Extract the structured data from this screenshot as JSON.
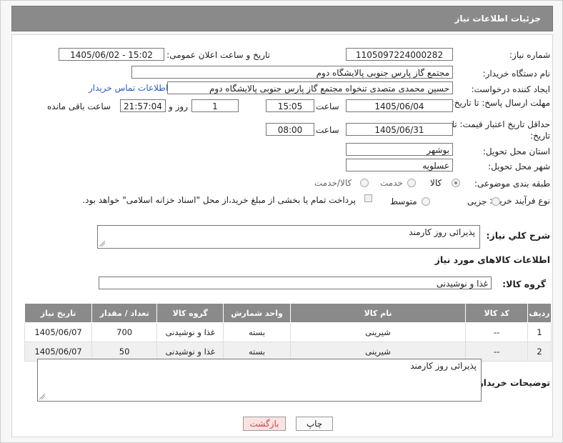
{
  "header": {
    "title": "جزئیات اطلاعات نیاز"
  },
  "fields": {
    "need_number_label": "شماره نیاز:",
    "need_number": "1105097224000282",
    "announce_label": "تاریخ و ساعت اعلان عمومی:",
    "announce_value": "1405/06/02 - 15:02",
    "buyer_org_label": "نام دستگاه خریدار:",
    "buyer_org": "مجتمع گاز پارس جنوبی  پالایشگاه دوم",
    "requester_label": "ایجاد کننده درخواست:",
    "requester": "حسین محمدی متصدی تنخواه مجتمع گاز پارس جنوبی  پالایشگاه دوم",
    "contact_link": "اطلاعات تماس خریدار",
    "reply_deadline_label": "مهلت ارسال پاسخ: تا تاریخ:",
    "reply_date": "1405/06/04",
    "time_label": "ساعت",
    "reply_time": "15:05",
    "days_value": "1",
    "days_label": "روز و",
    "remaining_time": "21:57:04",
    "remaining_label": "ساعت باقی مانده",
    "price_deadline_label": "حداقل تاریخ اعتبار قیمت: تا تاریخ:",
    "price_date": "1405/06/31",
    "price_time": "08:00",
    "province_label": "استان محل تحویل:",
    "province": "بوشهر",
    "city_label": "شهر محل تحویل:",
    "city": "عسلویه",
    "category_label": "طبقه بندی موضوعی:",
    "category_options": [
      "کالا",
      "خدمت",
      "کالا/خدمت"
    ],
    "process_label": "نوع فرآیند خرید :",
    "process_options": [
      "جزیی",
      "متوسط"
    ],
    "payment_note": "پرداخت تمام یا بخشی از مبلغ خرید،از محل \"اسناد خزانه اسلامی\" خواهد بود."
  },
  "description": {
    "label": "شرح کلي نياز:",
    "value": "پذیرائی روز کارمند"
  },
  "goods": {
    "section_title": "اطلاعات کالاهای مورد نیاز",
    "group_label": "گروه کالا:",
    "group_value": "غذا و نوشیدنی"
  },
  "table": {
    "headers": [
      "ردیف",
      "کد کالا",
      "نام کالا",
      "واحد شمارش",
      "گروه کالا",
      "تعداد / مقدار",
      "تاریخ نیاز"
    ],
    "rows": [
      [
        "1",
        "--",
        "شیرینی",
        "بسته",
        "غذا و نوشیدنی",
        "700",
        "1405/06/07"
      ],
      [
        "2",
        "--",
        "شیرینی",
        "بسته",
        "غذا و نوشیدنی",
        "50",
        "1405/06/07"
      ]
    ]
  },
  "buyer_notes": {
    "label": "توضیحات خریدار:",
    "value": "پذیرائی روز کارمند"
  },
  "buttons": {
    "print": "چاپ",
    "back": "بازگشت"
  }
}
